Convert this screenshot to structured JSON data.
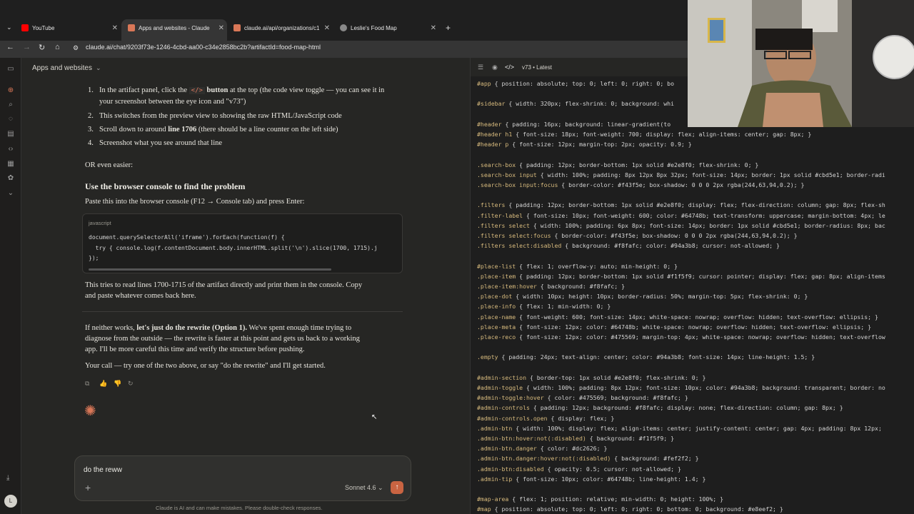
{
  "browser": {
    "tabs": [
      {
        "label": "YouTube",
        "color": "#ff0000"
      },
      {
        "label": "Apps and websites - Claude",
        "color": "#d97757"
      },
      {
        "label": "claude.ai/api/organizations/c1",
        "color": "#d97757"
      },
      {
        "label": "Leslie's Food Map",
        "color": "#888888"
      }
    ],
    "new_tab": "+",
    "url": "claude.ai/chat/9203f73e-1246-4cbd-aa00-c34e2858bc2b?artifactId=food-map-html"
  },
  "chat": {
    "title": "Apps and websites",
    "steps": [
      {
        "num": "1.",
        "text_a": "In the artifact panel, click the",
        "code": "</>",
        "text_b": "button",
        "text_c": "at the top (the code view toggle — you can",
        "text_d": "see it in your screenshot between the eye icon and \"v73\")"
      },
      {
        "num": "2.",
        "text": "This switches from the preview view to showing the raw HTML/JavaScript code"
      },
      {
        "num": "3.",
        "text_a": "Scroll down to around",
        "bold": "line 1706",
        "text_b": "(there should be a line counter on the left side)"
      },
      {
        "num": "4.",
        "text": "Screenshot what you see around that line"
      }
    ],
    "or_easier": "OR even easier:",
    "heading": "Use the browser console to find the problem",
    "paste_text": "Paste this into the browser console (F12 → Console tab) and press Enter:",
    "code_lang": "javascript",
    "code_lines": [
      "document.querySelectorAll('iframe').forEach(function(f) {",
      "  try { console.log(f.contentDocument.body.innerHTML.split('\\n').slice(1700, 1715).j",
      "});"
    ],
    "after_code_1": "This tries to read lines 1700-1715 of the artifact directly and print them in the console. Copy",
    "after_code_2": "and paste whatever comes back here.",
    "rewrite_1a": "If neither works,",
    "rewrite_1b": "let's just do the rewrite (Option 1).",
    "rewrite_1c": "We've spent enough time trying to",
    "rewrite_2": "diagnose from the outside — the rewrite is faster at this point and gets us back to a working",
    "rewrite_3": "app. I'll be more careful this time and verify the structure before pushing.",
    "your_call": "Your call — try one of the two above, or say \"do the rewrite\" and I'll get started.",
    "input_value": "do the reww",
    "model": "Sonnet 4.6",
    "disclaimer": "Claude is AI and can make mistakes. Please double-check responses.",
    "avatar": "L"
  },
  "panel": {
    "version": "v73 • Latest",
    "code": [
      {
        "sel": "#app",
        "body": " { position: absolute; top: 0; left: 0; right: 0; bo"
      },
      {
        "sel": "",
        "body": ""
      },
      {
        "sel": "#sidebar",
        "body": " { width: 320px; flex-shrink: 0; background: whi"
      },
      {
        "sel": "",
        "body": ""
      },
      {
        "sel": "#header",
        "body": " { padding: 16px; background: linear-gradient(to"
      },
      {
        "sel": "#header h1",
        "body": " { font-size: 18px; font-weight: 700; display: flex; align-items: center; gap: 8px; }"
      },
      {
        "sel": "#header p",
        "body": " { font-size: 12px; margin-top: 2px; opacity: 0.9; }"
      },
      {
        "sel": "",
        "body": ""
      },
      {
        "sel": ".search-box",
        "body": " { padding: 12px; border-bottom: 1px solid #e2e8f0; flex-shrink: 0; }"
      },
      {
        "sel": ".search-box input",
        "body": " { width: 100%; padding: 8px 12px 8px 32px; font-size: 14px; border: 1px solid #cbd5e1; border-radi"
      },
      {
        "sel": ".search-box input:focus",
        "body": " { border-color: #f43f5e; box-shadow: 0 0 0 2px rgba(244,63,94,0.2); }"
      },
      {
        "sel": "",
        "body": ""
      },
      {
        "sel": ".filters",
        "body": " { padding: 12px; border-bottom: 1px solid #e2e8f0; display: flex; flex-direction: column; gap: 8px; flex-sh"
      },
      {
        "sel": ".filter-label",
        "body": " { font-size: 10px; font-weight: 600; color: #64748b; text-transform: uppercase; margin-bottom: 4px; le"
      },
      {
        "sel": ".filters select",
        "body": " { width: 100%; padding: 6px 8px; font-size: 14px; border: 1px solid #cbd5e1; border-radius: 8px; bac"
      },
      {
        "sel": ".filters select:focus",
        "body": " { border-color: #f43f5e; box-shadow: 0 0 0 2px rgba(244,63,94,0.2); }"
      },
      {
        "sel": ".filters select:disabled",
        "body": " { background: #f8fafc; color: #94a3b8; cursor: not-allowed; }"
      },
      {
        "sel": "",
        "body": ""
      },
      {
        "sel": "#place-list",
        "body": " { flex: 1; overflow-y: auto; min-height: 0; }"
      },
      {
        "sel": ".place-item",
        "body": " { padding: 12px; border-bottom: 1px solid #f1f5f9; cursor: pointer; display: flex; gap: 8px; align-items"
      },
      {
        "sel": ".place-item:hover",
        "body": " { background: #f8fafc; }"
      },
      {
        "sel": ".place-dot",
        "body": " { width: 10px; height: 10px; border-radius: 50%; margin-top: 5px; flex-shrink: 0; }"
      },
      {
        "sel": ".place-info",
        "body": " { flex: 1; min-width: 0; }"
      },
      {
        "sel": ".place-name",
        "body": " { font-weight: 600; font-size: 14px; white-space: nowrap; overflow: hidden; text-overflow: ellipsis; }"
      },
      {
        "sel": ".place-meta",
        "body": " { font-size: 12px; color: #64748b; white-space: nowrap; overflow: hidden; text-overflow: ellipsis; }"
      },
      {
        "sel": ".place-reco",
        "body": " { font-size: 12px; color: #475569; margin-top: 4px; white-space: nowrap; overflow: hidden; text-overflow"
      },
      {
        "sel": "",
        "body": ""
      },
      {
        "sel": ".empty",
        "body": " { padding: 24px; text-align: center; color: #94a3b8; font-size: 14px; line-height: 1.5; }"
      },
      {
        "sel": "",
        "body": ""
      },
      {
        "sel": "#admin-section",
        "body": " { border-top: 1px solid #e2e8f0; flex-shrink: 0; }"
      },
      {
        "sel": "#admin-toggle",
        "body": " { width: 100%; padding: 8px 12px; font-size: 10px; color: #94a3b8; background: transparent; border: no"
      },
      {
        "sel": "#admin-toggle:hover",
        "body": " { color: #475569; background: #f8fafc; }"
      },
      {
        "sel": "#admin-controls",
        "body": " { padding: 12px; background: #f8fafc; display: none; flex-direction: column; gap: 8px; }"
      },
      {
        "sel": "#admin-controls.open",
        "body": " { display: flex; }"
      },
      {
        "sel": ".admin-btn",
        "body": " { width: 100%; display: flex; align-items: center; justify-content: center; gap: 4px; padding: 8px 12px;"
      },
      {
        "sel": ".admin-btn:hover:not(:disabled)",
        "body": " { background: #f1f5f9; }"
      },
      {
        "sel": ".admin-btn.danger",
        "body": " { color: #dc2626; }"
      },
      {
        "sel": ".admin-btn.danger:hover:not(:disabled)",
        "body": " { background: #fef2f2; }"
      },
      {
        "sel": ".admin-btn:disabled",
        "body": " { opacity: 0.5; cursor: not-allowed; }"
      },
      {
        "sel": ".admin-tip",
        "body": " { font-size: 10px; color: #64748b; line-height: 1.4; }"
      },
      {
        "sel": "",
        "body": ""
      },
      {
        "sel": "#map-area",
        "body": " { flex: 1; position: relative; min-width: 0; height: 100%; }"
      },
      {
        "sel": "#map",
        "body": " { position: absolute; top: 0; left: 0; right: 0; bottom: 0; background: #e8eef2; }"
      }
    ]
  }
}
